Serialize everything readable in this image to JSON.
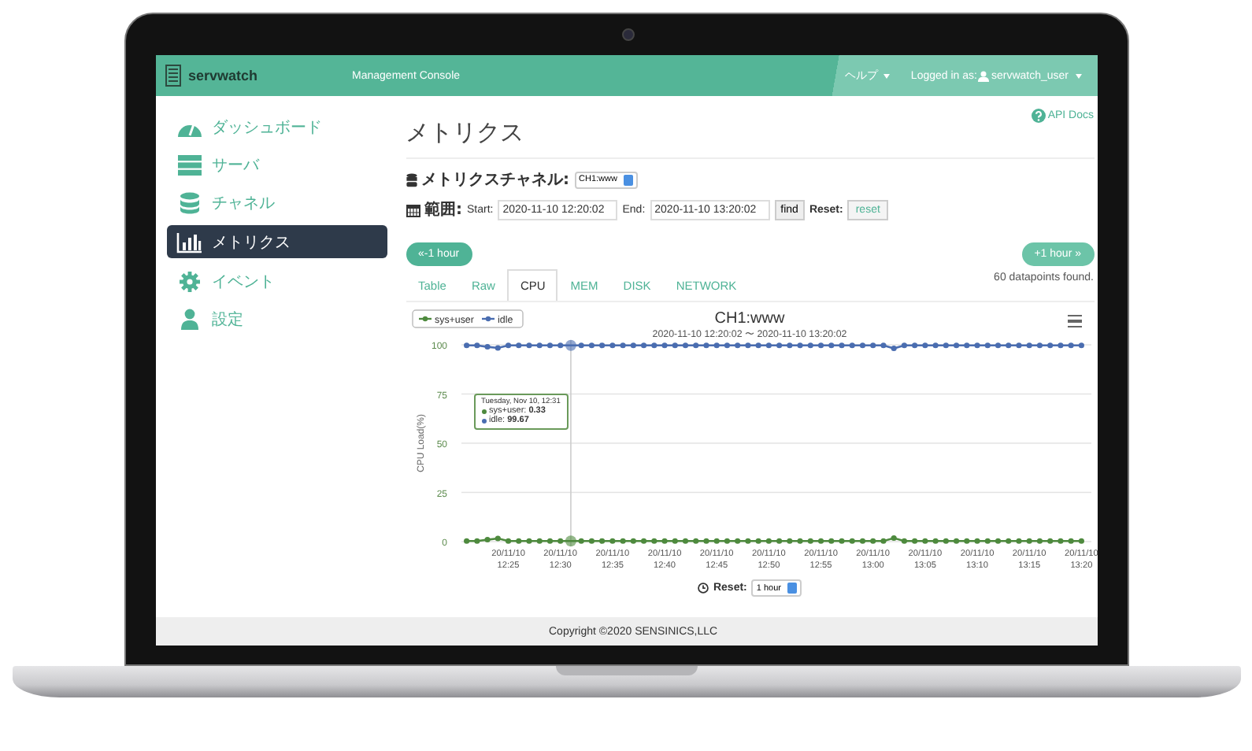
{
  "navbar": {
    "brand": "servwatch",
    "subtitle": "Management Console",
    "help": "ヘルプ",
    "login_label": "Logged in as:",
    "user": "servwatch_user"
  },
  "sidebar": {
    "items": [
      {
        "kind": "dashboard",
        "label": "ダッシュボード",
        "selected": false
      },
      {
        "kind": "server",
        "label": "サーバ",
        "selected": false
      },
      {
        "kind": "database",
        "label": "チャネル",
        "selected": false
      },
      {
        "kind": "chart",
        "label": "メトリクス",
        "selected": true
      },
      {
        "kind": "gear",
        "label": "イベント",
        "selected": false
      },
      {
        "kind": "user",
        "label": "設定",
        "selected": false
      }
    ]
  },
  "page": {
    "title": "メトリクス",
    "api_docs": "API Docs"
  },
  "channel": {
    "label": "メトリクスチャネル:",
    "value": "CH1:www"
  },
  "range": {
    "label": "範囲:",
    "start_label": "Start:",
    "start": "2020-11-10 12:20:02",
    "end_label": "End:",
    "end": "2020-11-10 13:20:02",
    "find": "find",
    "reset_label": "Reset:",
    "reset": "reset"
  },
  "nav_buttons": {
    "prev": "«-1 hour",
    "next": "+1 hour »"
  },
  "tabs": [
    {
      "label": "Table",
      "selected": false
    },
    {
      "label": "Raw",
      "selected": false
    },
    {
      "label": "CPU",
      "selected": true
    },
    {
      "label": "MEM",
      "selected": false
    },
    {
      "label": "DISK",
      "selected": false
    },
    {
      "label": "NETWORK",
      "selected": false
    }
  ],
  "count": "60 datapoints found.",
  "chart": {
    "subtitle": "2020-11-10 12:20:02 〜 2020-11-10 13:20:02",
    "tooltip": {
      "header": "Tuesday, Nov 10, 12:31",
      "lines": [
        "sys+user: **0.33**",
        "idle: **99.67**"
      ]
    },
    "chart_data": {
      "type": "line",
      "title": "CH1:www",
      "ylabel": "CPU Load(%)",
      "ylim": [
        0,
        100
      ],
      "yticks": [
        0,
        25,
        50,
        75,
        100
      ],
      "grid": true,
      "legend": true,
      "categories": [
        null,
        null,
        null,
        null,
        "20/11/10 12:25",
        null,
        null,
        null,
        null,
        "20/11/10 12:30",
        null,
        null,
        null,
        null,
        "20/11/10 12:35",
        null,
        null,
        null,
        null,
        "20/11/10 12:40",
        null,
        null,
        null,
        null,
        "20/11/10 12:45",
        null,
        null,
        null,
        null,
        "20/11/10 12:50",
        null,
        null,
        null,
        null,
        "20/11/10 12:55",
        null,
        null,
        null,
        null,
        "20/11/10 13:00",
        null,
        null,
        null,
        null,
        "20/11/10 13:05",
        null,
        null,
        null,
        null,
        "20/11/10 13:10",
        null,
        null,
        null,
        null,
        "20/11/10 13:15",
        null,
        null,
        null,
        null,
        "20/11/10 13:20"
      ],
      "series": [
        {
          "name": "sys+user",
          "color": "#4e8a3e",
          "marker": "circle",
          "values": [
            0.3,
            0.3,
            1,
            1.6,
            0.3,
            0.3,
            0.3,
            0.3,
            0.3,
            0.3,
            0.3,
            0.3,
            0.3,
            0.3,
            0.3,
            0.3,
            0.3,
            0.3,
            0.3,
            0.3,
            0.3,
            0.3,
            0.3,
            0.3,
            0.3,
            0.3,
            0.3,
            0.3,
            0.3,
            0.3,
            0.3,
            0.3,
            0.3,
            0.3,
            0.3,
            0.3,
            0.3,
            0.3,
            0.3,
            0.3,
            0.3,
            1.8,
            0.3,
            0.3,
            0.3,
            0.3,
            0.3,
            0.3,
            0.3,
            0.3,
            0.3,
            0.3,
            0.3,
            0.3,
            0.3,
            0.3,
            0.3,
            0.3,
            0.3,
            0.3
          ]
        },
        {
          "name": "idle",
          "color": "#4a6db0",
          "marker": "circle",
          "values": [
            99.7,
            99.7,
            99,
            98.4,
            99.7,
            99.7,
            99.7,
            99.7,
            99.7,
            99.7,
            99.7,
            99.7,
            99.7,
            99.7,
            99.7,
            99.7,
            99.7,
            99.7,
            99.7,
            99.7,
            99.7,
            99.7,
            99.7,
            99.7,
            99.7,
            99.7,
            99.7,
            99.7,
            99.7,
            99.7,
            99.7,
            99.7,
            99.7,
            99.7,
            99.7,
            99.7,
            99.7,
            99.7,
            99.7,
            99.7,
            99.7,
            98.2,
            99.7,
            99.7,
            99.7,
            99.7,
            99.7,
            99.7,
            99.7,
            99.7,
            99.7,
            99.7,
            99.7,
            99.7,
            99.7,
            99.7,
            99.7,
            99.7,
            99.7,
            99.7
          ]
        }
      ]
    }
  },
  "zoom_reset": {
    "label": "Reset:",
    "value": "1 hour"
  },
  "footer": "Copyright ©2020 SENSINICS,LLC"
}
